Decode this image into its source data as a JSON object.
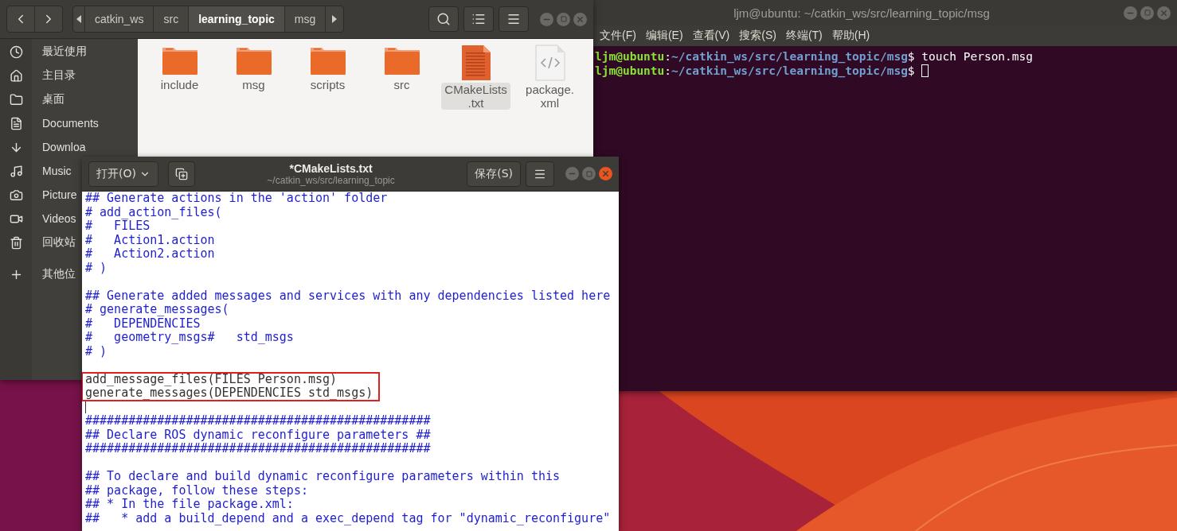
{
  "file_manager": {
    "path_bar": [
      {
        "label": "catkin_ws",
        "selected": false
      },
      {
        "label": "src",
        "selected": false
      },
      {
        "label": "learning_topic",
        "selected": true
      },
      {
        "label": "msg",
        "selected": false
      }
    ],
    "sidebar": {
      "items": [
        {
          "kind": "recent",
          "label": "最近使用"
        },
        {
          "kind": "home",
          "label": "主目录"
        },
        {
          "kind": "folder",
          "label": "桌面"
        },
        {
          "kind": "document",
          "label": "Documents"
        },
        {
          "kind": "download",
          "label": "Downloa"
        },
        {
          "kind": "music",
          "label": "Music"
        },
        {
          "kind": "camera",
          "label": "Picture"
        },
        {
          "kind": "video",
          "label": "Videos"
        },
        {
          "kind": "trash",
          "label": "回收站"
        },
        {
          "kind": "other",
          "label": "其他位"
        }
      ]
    },
    "files": [
      {
        "kind": "folder",
        "label_lines": [
          "include"
        ],
        "selected": false
      },
      {
        "kind": "folder",
        "label_lines": [
          "msg"
        ],
        "selected": false
      },
      {
        "kind": "folder",
        "label_lines": [
          "scripts"
        ],
        "selected": false
      },
      {
        "kind": "folder",
        "label_lines": [
          "src"
        ],
        "selected": false
      },
      {
        "kind": "text",
        "label_lines": [
          "CMakeLists",
          ".txt"
        ],
        "selected": true
      },
      {
        "kind": "code",
        "label_lines": [
          "package.",
          "xml"
        ],
        "selected": false
      }
    ]
  },
  "terminal": {
    "title": "ljm@ubuntu: ~/catkin_ws/src/learning_topic/msg",
    "menu": [
      "文件(F)",
      "编辑(E)",
      "查看(V)",
      "搜索(S)",
      "终端(T)",
      "帮助(H)"
    ],
    "lines": [
      {
        "user": "ljm@ubuntu",
        "sep": ":",
        "path": "~/catkin_ws/src/learning_topic/msg",
        "symbol": "$",
        "command": "touch Person.msg",
        "cursor": false
      },
      {
        "user": "ljm@ubuntu",
        "sep": ":",
        "path": "~/catkin_ws/src/learning_topic/msg",
        "symbol": "$",
        "cursor": true
      }
    ]
  },
  "editor": {
    "open_button": "打开(O)",
    "title": "*CMakeLists.txt",
    "subtitle": "~/catkin_ws/src/learning_topic",
    "save_button": "保存(S)",
    "lines": [
      {
        "kind": "comment",
        "text": "## Generate actions in the 'action' folder"
      },
      {
        "kind": "comment",
        "text": "# add_action_files("
      },
      {
        "kind": "comment",
        "text": "#   FILES"
      },
      {
        "kind": "comment",
        "text": "#   Action1.action"
      },
      {
        "kind": "comment",
        "text": "#   Action2.action"
      },
      {
        "kind": "comment",
        "text": "# )"
      },
      {
        "kind": "blank"
      },
      {
        "kind": "comment",
        "text": "## Generate added messages and services with any dependencies listed here"
      },
      {
        "kind": "comment",
        "text": "# generate_messages("
      },
      {
        "kind": "comment",
        "text": "#   DEPENDENCIES"
      },
      {
        "kind": "comment",
        "text": "#   geometry_msgs#   std_msgs"
      },
      {
        "kind": "comment",
        "text": "# )"
      },
      {
        "kind": "blank"
      },
      {
        "kind": "code",
        "text": "add_message_files(FILES Person.msg)",
        "boxed": true
      },
      {
        "kind": "code",
        "text": "generate_messages(DEPENDENCIES std_msgs)",
        "boxed": true
      },
      {
        "kind": "cursor"
      },
      {
        "kind": "comment",
        "text": "################################################"
      },
      {
        "kind": "comment",
        "text": "## Declare ROS dynamic reconfigure parameters ##"
      },
      {
        "kind": "comment",
        "text": "################################################"
      },
      {
        "kind": "blank"
      },
      {
        "kind": "comment",
        "text": "## To declare and build dynamic reconfigure parameters within this"
      },
      {
        "kind": "comment",
        "text": "## package, follow these steps:"
      },
      {
        "kind": "comment",
        "text": "## * In the file package.xml:"
      },
      {
        "kind": "comment",
        "text": "##   * add a build_depend and a exec_depend tag for \"dynamic_reconfigure\""
      }
    ]
  }
}
